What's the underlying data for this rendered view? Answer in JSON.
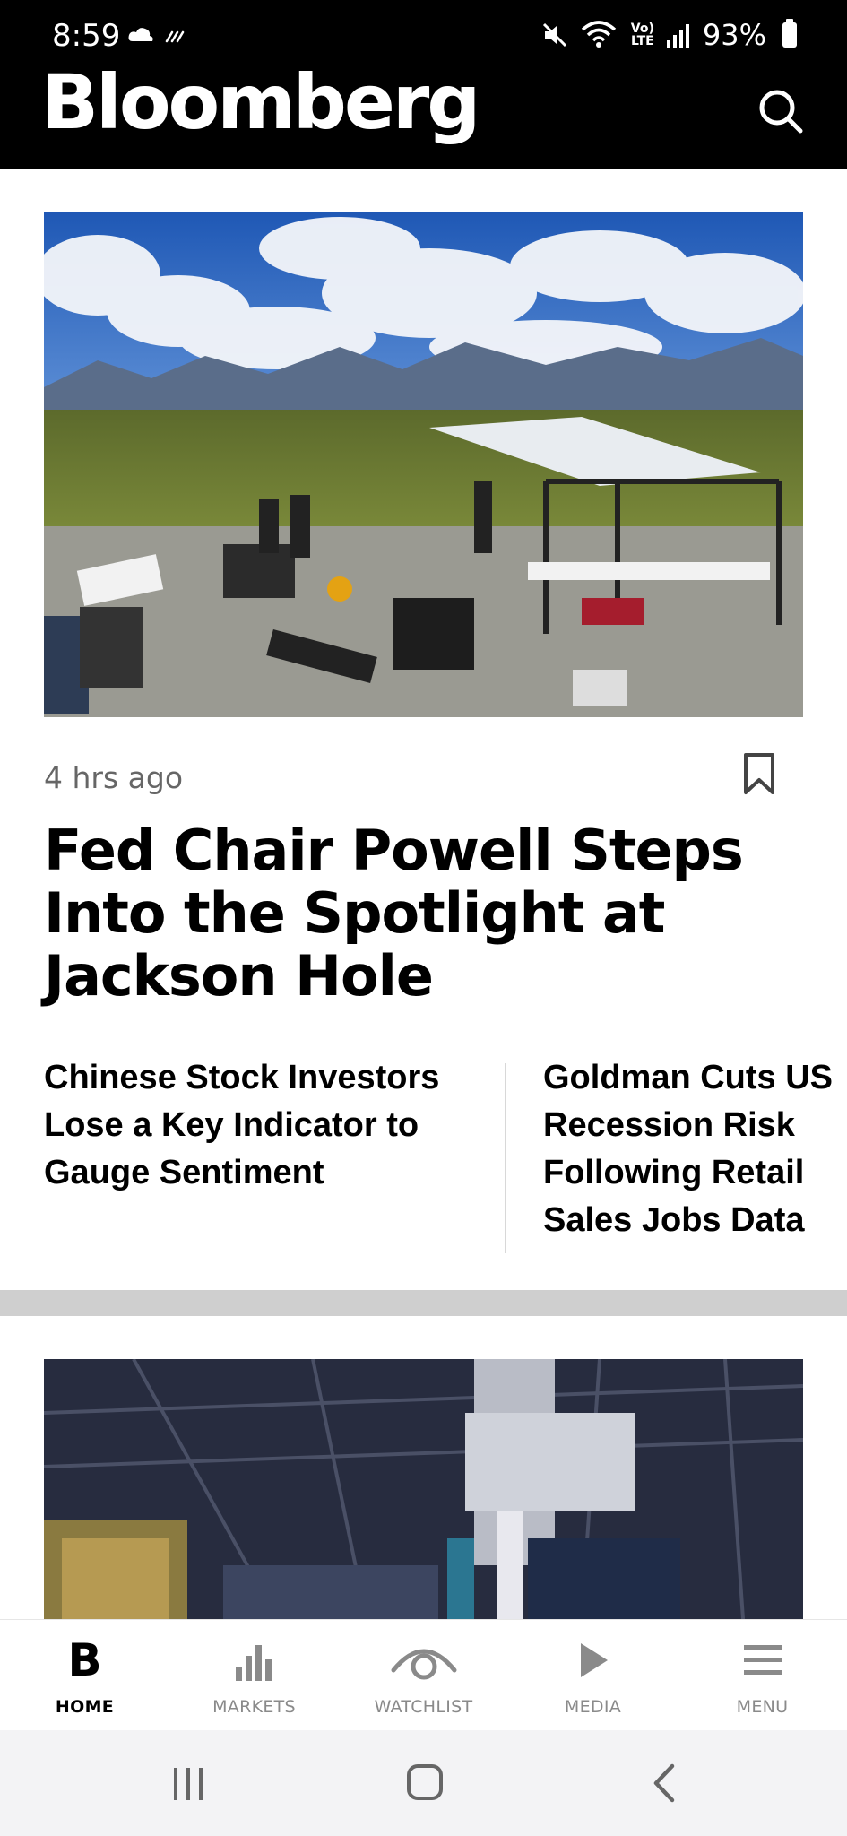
{
  "status_bar": {
    "time": "8:59",
    "network_label_top": "Vo)",
    "network_label_bottom": "LTE",
    "battery": "93%"
  },
  "header": {
    "brand": "Bloomberg",
    "search_icon": "search-icon"
  },
  "lead_story": {
    "time_ago": "4 hrs ago",
    "headline": "Fed Chair Powell Steps Into the Spotlight at Jackson Hole",
    "bookmark_icon": "bookmark-icon"
  },
  "related_stories": [
    {
      "title": "Chinese Stock Investors Lose a Key Indicator to Gauge Sentiment"
    },
    {
      "title": "Goldman Cuts US Recession Risk Following Retail Sales Jobs Data"
    }
  ],
  "bottom_nav": {
    "items": [
      {
        "label": "HOME",
        "icon": "home-b-icon",
        "glyph": "B",
        "active": true
      },
      {
        "label": "MARKETS",
        "icon": "bar-chart-icon",
        "active": false
      },
      {
        "label": "WATCHLIST",
        "icon": "eye-icon",
        "active": false
      },
      {
        "label": "MEDIA",
        "icon": "play-icon",
        "active": false
      },
      {
        "label": "MENU",
        "icon": "hamburger-icon",
        "active": false
      }
    ]
  },
  "system_nav": {
    "recents_icon": "recents-icon",
    "home_icon": "home-icon",
    "back_icon": "back-icon"
  },
  "colors": {
    "header_bg": "#000000",
    "page_bg": "#ffffff",
    "separator": "#cfcfcf",
    "nav_inactive": "#8a8a8a"
  }
}
